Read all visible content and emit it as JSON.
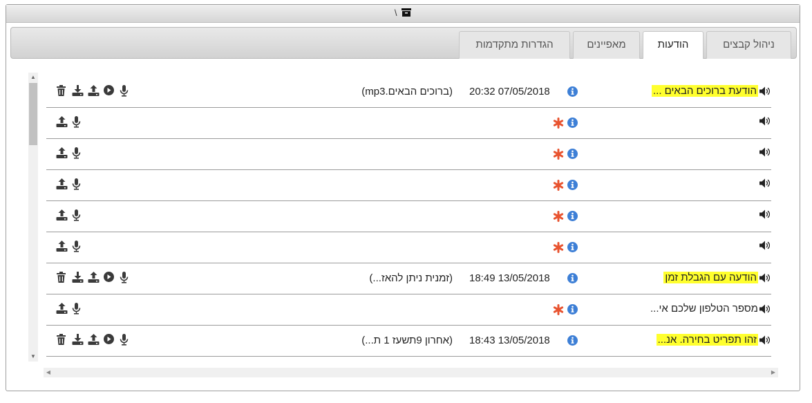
{
  "window": {
    "title": "\\",
    "title_icon": "archive-box-icon"
  },
  "tabs": [
    {
      "label": "ניהול קבצים",
      "active": false
    },
    {
      "label": "הודעות",
      "active": true
    },
    {
      "label": "מאפיינים",
      "active": false
    },
    {
      "label": "הגדרות מתקדמות",
      "active": false
    }
  ],
  "rows": [
    {
      "name": "הודעת ברוכים הבאים ...",
      "highlight": true,
      "date": "20:32 07/05/2018",
      "desc": "(ברוכים הבאים.mp3)",
      "has_file": true
    },
    {
      "name": "",
      "highlight": false,
      "date": "",
      "desc": "",
      "has_file": false
    },
    {
      "name": "",
      "highlight": false,
      "date": "",
      "desc": "",
      "has_file": false
    },
    {
      "name": "",
      "highlight": false,
      "date": "",
      "desc": "",
      "has_file": false
    },
    {
      "name": "",
      "highlight": false,
      "date": "",
      "desc": "",
      "has_file": false
    },
    {
      "name": "",
      "highlight": false,
      "date": "",
      "desc": "",
      "has_file": false
    },
    {
      "name": "הודעה עם הגבלת זמן",
      "highlight": true,
      "date": "18:49 13/05/2018",
      "desc": "(זמנית ניתן להאז...)",
      "has_file": true
    },
    {
      "name": "מספר הטלפון שלכם אי...",
      "highlight": false,
      "date": "",
      "desc": "",
      "has_file": false
    },
    {
      "name": "זהו תפריט בחירה. אנ...",
      "highlight": true,
      "date": "18:43 13/05/2018",
      "desc": "(אחרון 9תשעז 1 ת...)",
      "has_file": true
    }
  ],
  "colors": {
    "info_blue": "#3d7fd6",
    "required_star": "#e8532f",
    "highlight": "#ffff2e",
    "icon_dark": "#3a3a3a"
  },
  "icons": {
    "actions_full": [
      "trash-icon",
      "download-icon",
      "upload-icon",
      "play-icon",
      "microphone-icon"
    ],
    "actions_empty": [
      "upload-icon",
      "microphone-icon"
    ],
    "info": "info-icon",
    "required": "asterisk-icon",
    "speaker": "speaker-icon"
  }
}
